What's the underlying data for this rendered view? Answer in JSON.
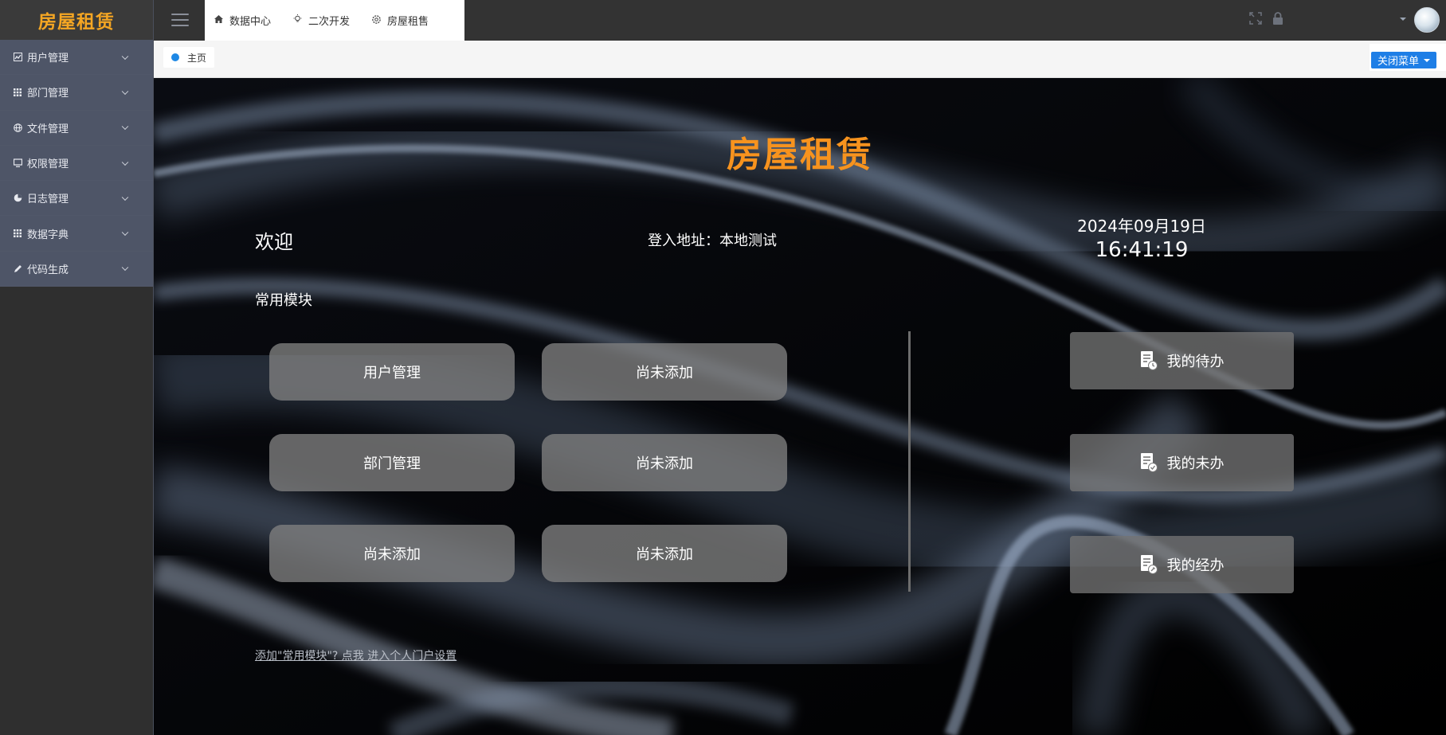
{
  "app": {
    "logo": "房屋租赁"
  },
  "sidebar": {
    "items": [
      {
        "label": "用户管理",
        "icon": "chart-icon"
      },
      {
        "label": "部门管理",
        "icon": "grid-icon"
      },
      {
        "label": "文件管理",
        "icon": "globe-icon"
      },
      {
        "label": "权限管理",
        "icon": "monitor-icon"
      },
      {
        "label": "日志管理",
        "icon": "pie-icon"
      },
      {
        "label": "数据字典",
        "icon": "grid-icon"
      },
      {
        "label": "代码生成",
        "icon": "pencil-icon"
      }
    ]
  },
  "topbar": {
    "tabs": [
      {
        "label": "数据中心",
        "icon": "home-icon"
      },
      {
        "label": "二次开发",
        "icon": "bulb-icon"
      },
      {
        "label": "房屋租售",
        "icon": "gear-icon"
      }
    ]
  },
  "breadcrumb": {
    "home": "主页",
    "close_menu": "关闭菜单"
  },
  "main": {
    "title": "房屋租赁",
    "welcome": "欢迎",
    "login_address": "登入地址：本地测试",
    "date": "2024年09月19日",
    "time": "16:41:19",
    "section_label": "常用模块",
    "modules": [
      "用户管理",
      "尚未添加",
      "部门管理",
      "尚未添加",
      "尚未添加",
      "尚未添加"
    ],
    "tasks": [
      "我的待办",
      "我的未办",
      "我的经办"
    ],
    "footer_link": "添加\"常用模块\"? 点我 进入个人门户设置"
  },
  "colors": {
    "accent": "#f7931e",
    "primary": "#1e7ee6",
    "sidebar_menu": "#4e5567"
  }
}
